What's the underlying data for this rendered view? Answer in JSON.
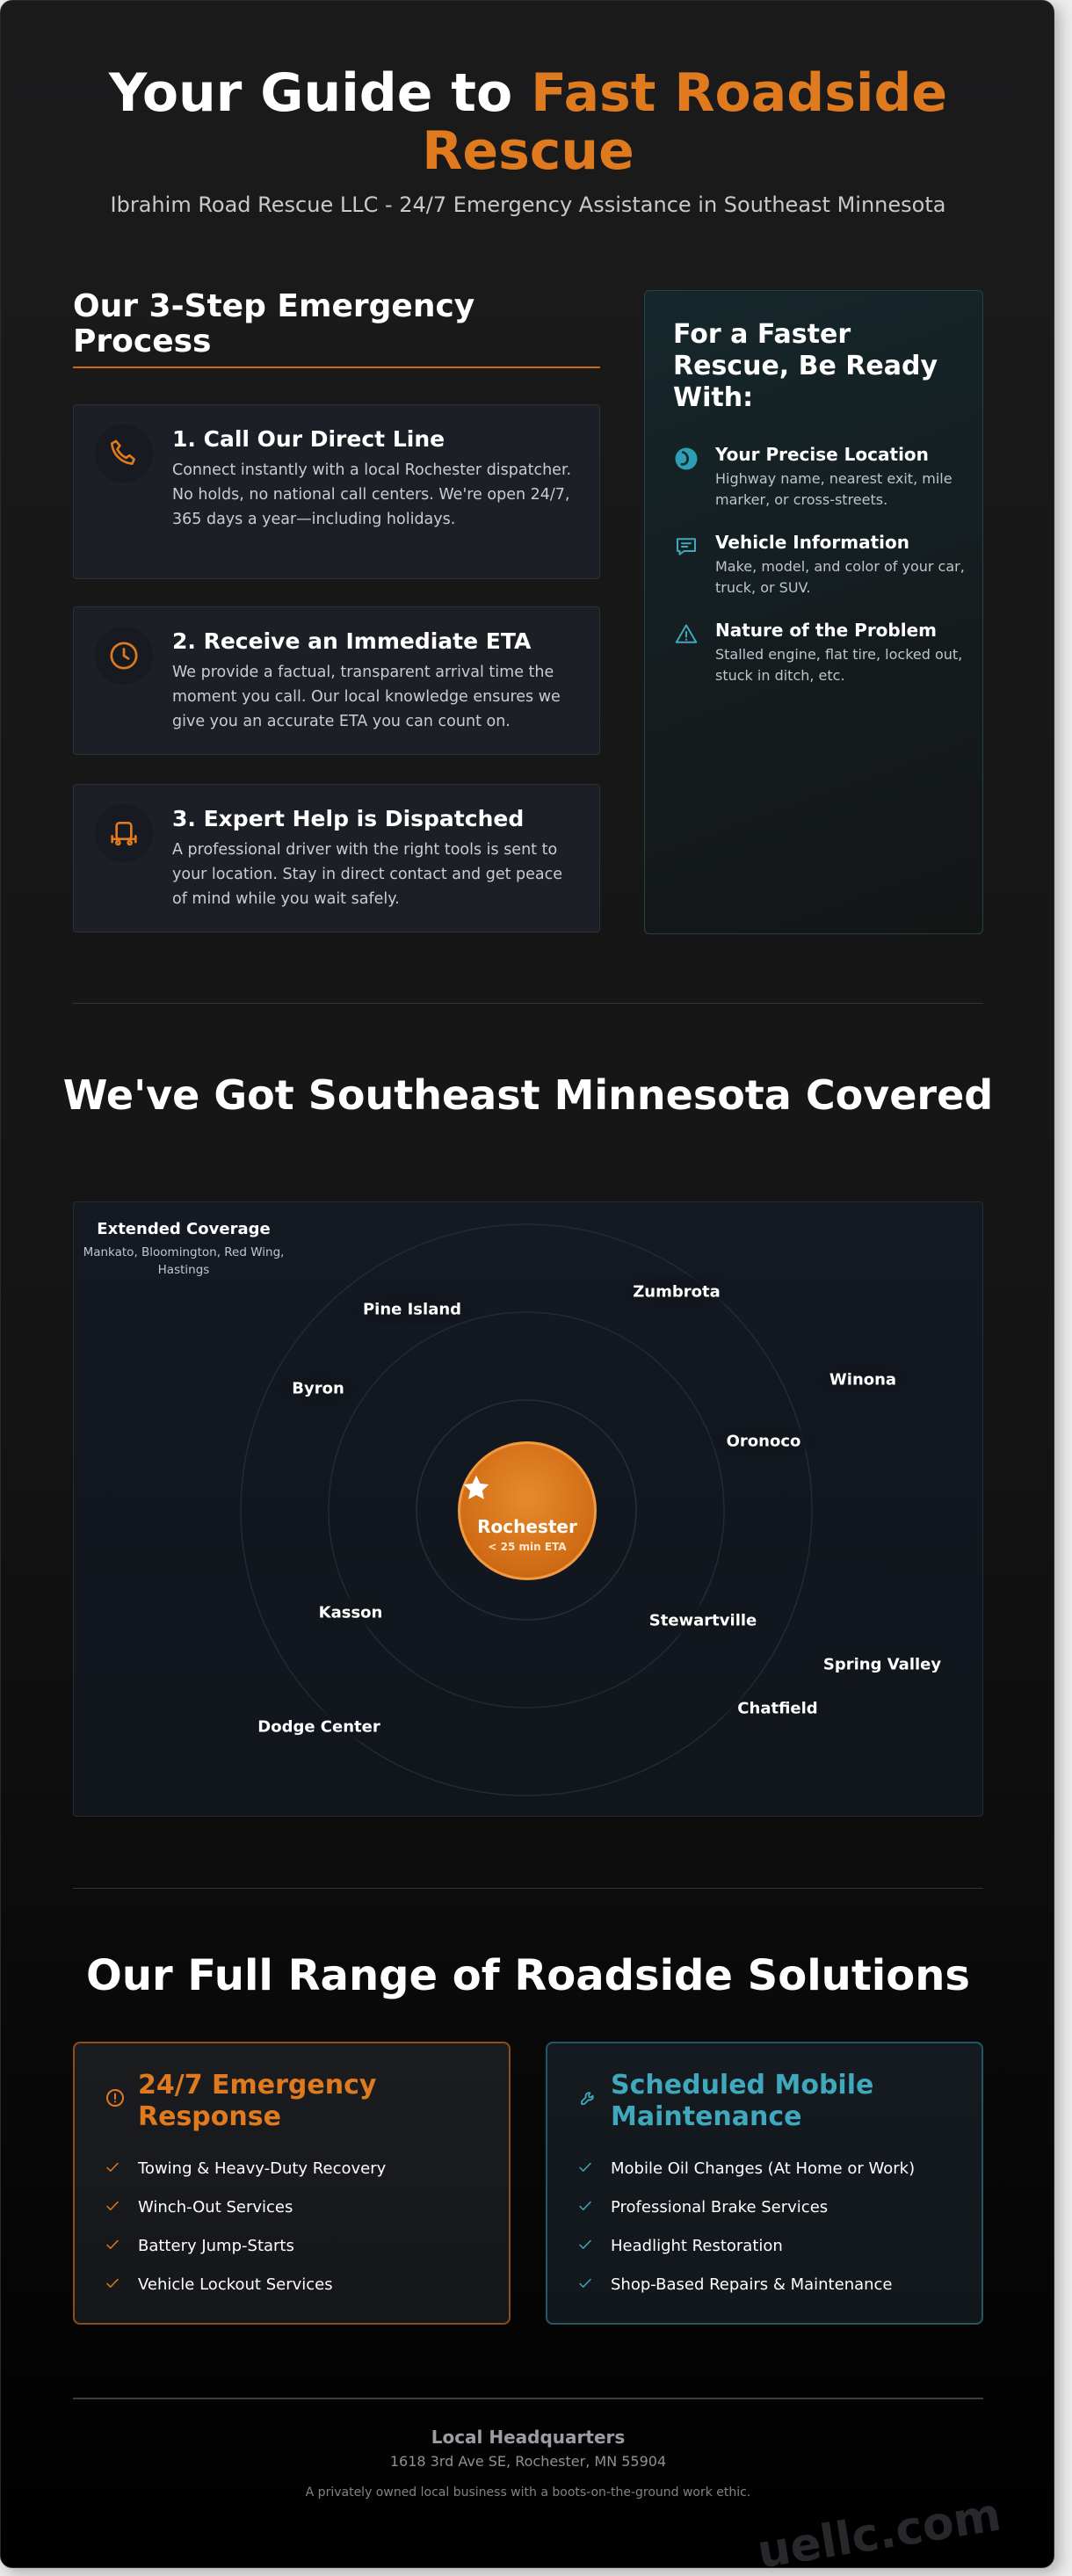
{
  "hero": {
    "title_part1": "Your Guide to ",
    "title_accent": "Fast Roadside Rescue",
    "subtitle": "Ibrahim Road Rescue LLC - 24/7 Emergency Assistance in Southeast Minnesota"
  },
  "process": {
    "title": "Our 3-Step Emergency Process",
    "steps": [
      {
        "icon": "phone-icon",
        "title": "1. Call Our Direct Line",
        "desc": "Connect instantly with a local Rochester dispatcher. No holds, no national call centers. We're open 24/7, 365 days a year—including holidays."
      },
      {
        "icon": "clock-icon",
        "title": "2. Receive an Immediate ETA",
        "desc": "We provide a factual, transparent arrival time the moment you call. Our local knowledge ensures we give you an accurate ETA you can count on."
      },
      {
        "icon": "tow-truck-icon",
        "title": "3. Expert Help is Dispatched",
        "desc": "A professional driver with the right tools is sent to your location. Stay in direct contact and get peace of mind while you wait safely."
      }
    ]
  },
  "ready": {
    "title": "For a Faster Rescue, Be Ready With:",
    "items": [
      {
        "icon": "location-icon",
        "title": "Your Precise Location",
        "desc": "Highway name, nearest exit, mile marker, or cross-streets."
      },
      {
        "icon": "chat-icon",
        "title": "Vehicle Information",
        "desc": "Make, model, and color of your car, truck, or SUV."
      },
      {
        "icon": "warning-icon",
        "title": "Nature of the Problem",
        "desc": "Stalled engine, flat tire, locked out, stuck in ditch, etc."
      }
    ]
  },
  "coverage": {
    "title": "We've Got Southeast Minnesota Covered",
    "extended_title": "Extended Coverage",
    "extended_desc": "Mankato, Bloomington, Red Wing, Hastings",
    "center_name": "Rochester",
    "center_eta": "< 25 min ETA",
    "towns": [
      "Pine Island",
      "Zumbrota",
      "Byron",
      "Winona",
      "Oronoco",
      "Kasson",
      "Stewartville",
      "Spring Valley",
      "Chatfield",
      "Dodge Center"
    ]
  },
  "solutions": {
    "title": "Our Full Range of Roadside Solutions",
    "emergency": {
      "icon": "alert-circle-icon",
      "title": "24/7 Emergency Response",
      "items": [
        "Towing & Heavy-Duty Recovery",
        "Winch-Out Services",
        "Battery Jump-Starts",
        "Vehicle Lockout Services"
      ]
    },
    "maintenance": {
      "icon": "wrench-icon",
      "title": "Scheduled Mobile Maintenance",
      "items": [
        "Mobile Oil Changes (At Home or Work)",
        "Professional Brake Services",
        "Headlight Restoration",
        "Shop-Based Repairs & Maintenance"
      ]
    }
  },
  "footer": {
    "heading": "Local Headquarters",
    "address": "1618 3rd Ave SE, Rochester, MN 55904",
    "note": "A privately owned local business with a boots-on-the-ground work ethic."
  },
  "watermark": "uellc.com",
  "colors": {
    "orange": "#e07a1f",
    "teal": "#3fa8bd",
    "background": "#141414"
  }
}
